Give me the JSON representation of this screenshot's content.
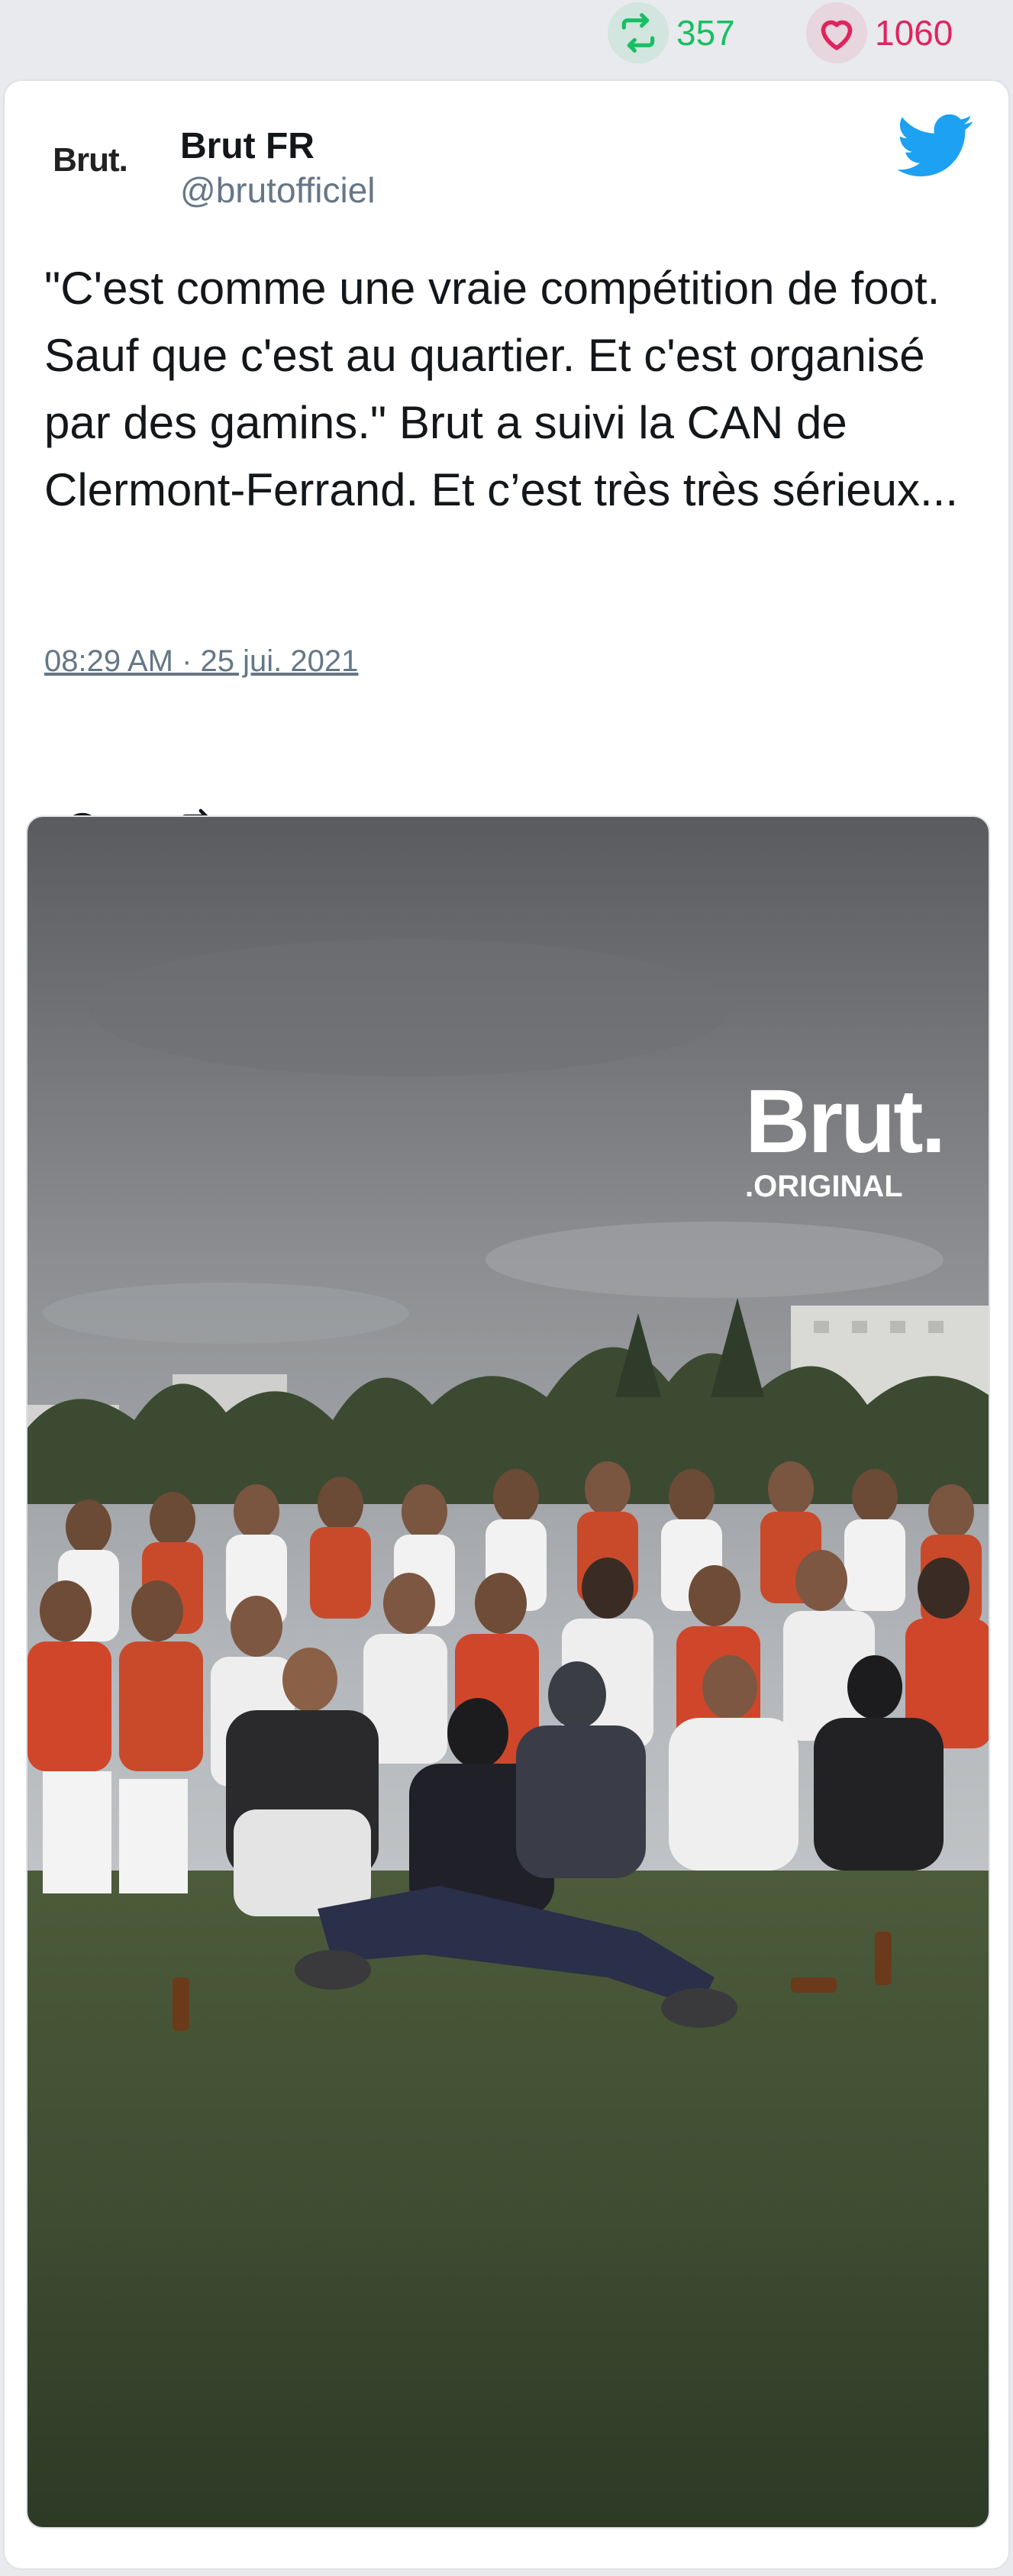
{
  "stats": {
    "retweet_count": "357",
    "like_count": "1060",
    "retweet_color": "#17bf63",
    "like_color": "#e0245e"
  },
  "tweet": {
    "avatar_text": "Brut.",
    "display_name": "Brut FR",
    "handle": "@brutofficiel",
    "text": "\"C'est comme une vraie compétition de foot. Sauf que c'est au quartier. Et c'est organisé par des gamins.\" Brut a suivi la CAN de Clermont-Ferrand. Et c’est très très sérieux...",
    "timestamp": "08:29 AM · 25 jui. 2021",
    "brand_icon": "twitter-bird-icon",
    "brand_color": "#1da1f2"
  },
  "actions": {
    "reply_icon": "reply-icon",
    "retweet_icon": "retweet-icon",
    "like_icon": "heart-icon"
  },
  "media": {
    "watermark_title": "Brut.",
    "watermark_subtitle": ".ORIGINAL"
  }
}
